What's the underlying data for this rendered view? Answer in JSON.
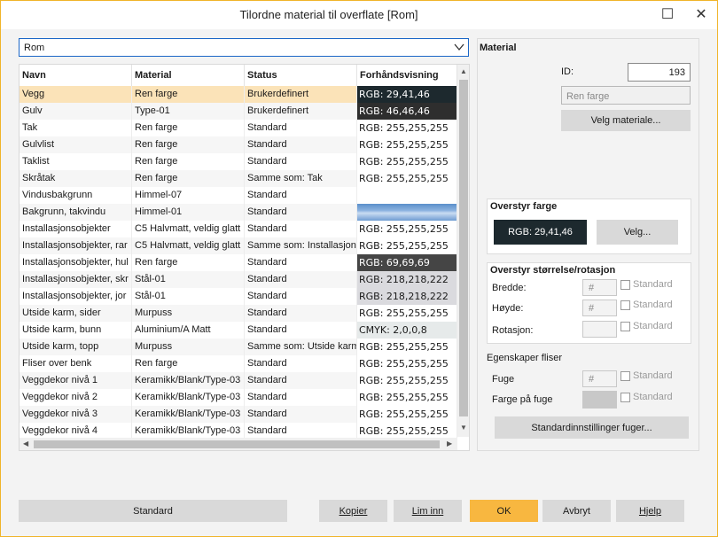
{
  "window": {
    "title": "Tilordne material til overflate [Rom]"
  },
  "combo": {
    "value": "Rom"
  },
  "table": {
    "headers": [
      "Navn",
      "Material",
      "Status",
      "Forhåndsvisning"
    ],
    "rows": [
      {
        "name": "Vegg",
        "material": "Ren farge",
        "status": "Brukerdefinert",
        "preview": "RGB: 29,41,46",
        "bg": "#1d292e",
        "dark": true,
        "selected": true
      },
      {
        "name": "Gulv",
        "material": "Type-01",
        "status": "Brukerdefinert",
        "preview": "RGB: 46,46,46",
        "bg": "#2e2e2e",
        "dark": true
      },
      {
        "name": "Tak",
        "material": "Ren farge",
        "status": "Standard",
        "preview": "RGB: 255,255,255",
        "bg": "#ffffff"
      },
      {
        "name": "Gulvlist",
        "material": "Ren farge",
        "status": "Standard",
        "preview": "RGB: 255,255,255",
        "bg": "#ffffff"
      },
      {
        "name": "Taklist",
        "material": "Ren farge",
        "status": "Standard",
        "preview": "RGB: 255,255,255",
        "bg": "#ffffff"
      },
      {
        "name": "Skråtak",
        "material": "Ren farge",
        "status": "Samme som: Tak",
        "preview": "RGB: 255,255,255",
        "bg": "#ffffff"
      },
      {
        "name": "Vindusbakgrunn",
        "material": "Himmel-07",
        "status": "Standard",
        "preview": "",
        "bg": "#ffffff"
      },
      {
        "name": "Bakgrunn, takvindu",
        "material": "Himmel-01",
        "status": "Standard",
        "preview": "",
        "bg": "sky"
      },
      {
        "name": "Installasjonsobjekter",
        "material": "C5 Halvmatt, veldig glatt",
        "status": "Standard",
        "preview": "RGB: 255,255,255",
        "bg": "#ffffff"
      },
      {
        "name": "Installasjonsobjekter, rar",
        "material": "C5 Halvmatt, veldig glatt",
        "status": "Samme som: Installasjon",
        "preview": "RGB: 255,255,255",
        "bg": "#ffffff"
      },
      {
        "name": "Installasjonsobjekter, hul",
        "material": "Ren farge",
        "status": "Standard",
        "preview": "RGB: 69,69,69",
        "bg": "#454545",
        "dark": true
      },
      {
        "name": "Installasjonsobjekter, skr",
        "material": "Stål-01",
        "status": "Standard",
        "preview": "RGB: 218,218,222",
        "bg": "#dadade"
      },
      {
        "name": "Installasjonsobjekter, jor",
        "material": "Stål-01",
        "status": "Standard",
        "preview": "RGB: 218,218,222",
        "bg": "#dadade"
      },
      {
        "name": "Utside karm, sider",
        "material": "Murpuss",
        "status": "Standard",
        "preview": "RGB: 255,255,255",
        "bg": "#ffffff"
      },
      {
        "name": "Utside karm, bunn",
        "material": "Aluminium/A Matt",
        "status": "Standard",
        "preview": "CMYK: 2,0,0,8",
        "bg": "#e6eaea"
      },
      {
        "name": "Utside karm, topp",
        "material": "Murpuss",
        "status": "Samme som: Utside karm",
        "preview": "RGB: 255,255,255",
        "bg": "#ffffff"
      },
      {
        "name": "Fliser over benk",
        "material": "Ren farge",
        "status": "Standard",
        "preview": "RGB: 255,255,255",
        "bg": "#ffffff"
      },
      {
        "name": "Veggdekor nivå 1",
        "material": "Keramikk/Blank/Type-03",
        "status": "Standard",
        "preview": "RGB: 255,255,255",
        "bg": "#ffffff"
      },
      {
        "name": "Veggdekor nivå 2",
        "material": "Keramikk/Blank/Type-03",
        "status": "Standard",
        "preview": "RGB: 255,255,255",
        "bg": "#ffffff"
      },
      {
        "name": "Veggdekor nivå 3",
        "material": "Keramikk/Blank/Type-03",
        "status": "Standard",
        "preview": "RGB: 255,255,255",
        "bg": "#ffffff"
      },
      {
        "name": "Veggdekor nivå 4",
        "material": "Keramikk/Blank/Type-03",
        "status": "Standard",
        "preview": "RGB: 255,255,255",
        "bg": "#ffffff"
      }
    ]
  },
  "material": {
    "heading": "Material",
    "id_label": "ID:",
    "id_value": "193",
    "name_value": "Ren farge",
    "choose_button": "Velg materiale..."
  },
  "override_color": {
    "heading": "Overstyr farge",
    "swatch_text": "RGB: 29,41,46",
    "swatch_color": "#1d292e",
    "choose_button": "Velg..."
  },
  "override_size": {
    "heading": "Overstyr størrelse/rotasjon",
    "width_label": "Bredde:",
    "height_label": "Høyde:",
    "rotation_label": "Rotasjon:",
    "hash": "#",
    "standard": "Standard"
  },
  "tiles": {
    "heading": "Egenskaper fliser",
    "joint_label": "Fuge",
    "joint_color_label": "Farge på fuge",
    "hash": "#",
    "standard": "Standard",
    "defaults_button": "Standardinnstillinger fuger..."
  },
  "footer": {
    "standard": "Standard",
    "copy": "Kopier",
    "paste": "Lim inn",
    "ok": "OK",
    "cancel": "Avbryt",
    "help": "Hjelp"
  },
  "icons": [
    "maximize-icon",
    "close-icon",
    "chevron-down-icon",
    "scroll-up-icon",
    "scroll-down-icon",
    "scroll-left-icon",
    "scroll-right-icon"
  ]
}
